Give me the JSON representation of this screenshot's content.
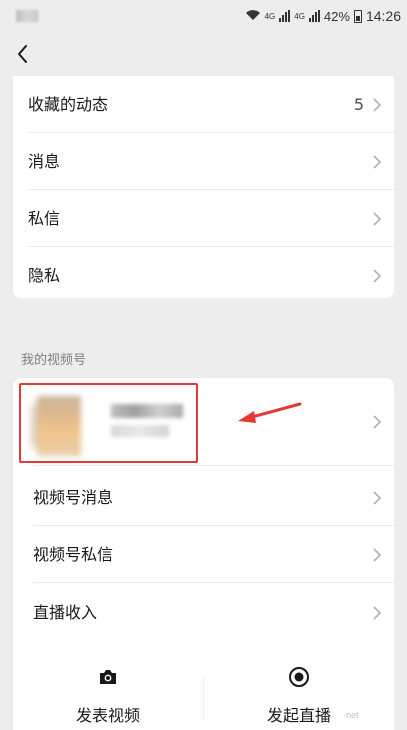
{
  "status": {
    "battery": "42%",
    "time": "14:26",
    "network_1": "4G",
    "network_2": "4G"
  },
  "nav": {
    "back_icon": "chevron-left-icon"
  },
  "top_card": {
    "items": [
      {
        "label": "收藏的动态",
        "value": "5"
      },
      {
        "label": "消息",
        "value": ""
      },
      {
        "label": "私信",
        "value": ""
      },
      {
        "label": "隐私",
        "value": ""
      }
    ]
  },
  "channels_section": {
    "title": "我的视频号",
    "profile": {
      "name": "",
      "subtitle": ""
    },
    "items": [
      {
        "label": "视频号消息"
      },
      {
        "label": "视频号私信"
      },
      {
        "label": "直播收入"
      }
    ]
  },
  "bottom_actions": [
    {
      "label": "发表视频",
      "icon": "camera-icon"
    },
    {
      "label": "发起直播",
      "icon": "live-record-icon"
    }
  ],
  "colors": {
    "page_bg": "#ededed",
    "card_bg": "#ffffff",
    "annotation_red": "#e53935"
  }
}
